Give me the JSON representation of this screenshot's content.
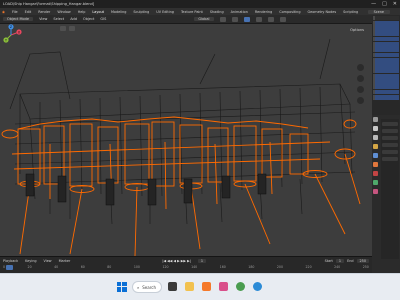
{
  "window": {
    "path": "LOAD\\Ship Hangar\\Format\\Shipping_Hangar.blend]",
    "buttons": [
      "—",
      "□",
      "✕"
    ]
  },
  "menus": [
    "File",
    "Edit",
    "Render",
    "Window",
    "Help"
  ],
  "workspaces": [
    "Layout",
    "Modeling",
    "Sculpting",
    "UV Editing",
    "Texture Paint",
    "Shading",
    "Animation",
    "Rendering",
    "Compositing",
    "Geometry Nodes",
    "Scripting"
  ],
  "active_workspace": "Layout",
  "scene_name": "Scene",
  "header": {
    "mode": "Object Mode",
    "menus": [
      "View",
      "Select",
      "Add",
      "Object",
      "GIS"
    ],
    "transform": "Global"
  },
  "viewport": {
    "options_label": "Options",
    "selection_color": "#ff6a00",
    "wire_color": "#111111",
    "gizmo": {
      "x": "X",
      "y": "Y",
      "z": "Z"
    }
  },
  "timeline": {
    "menus": [
      "Playback",
      "Keying",
      "View",
      "Marker"
    ],
    "current_frame": "1",
    "start_label": "Start",
    "start": "1",
    "end_label": "End",
    "end": "250",
    "ruler": [
      "0",
      "20",
      "40",
      "60",
      "80",
      "100",
      "120",
      "140",
      "160",
      "180",
      "200",
      "220",
      "240",
      "250"
    ]
  },
  "taskbar": {
    "search_label": "Search",
    "icon_names": [
      "files-icon",
      "explorer-icon",
      "blender-icon",
      "app-icon",
      "chrome-icon",
      "edge-icon"
    ]
  }
}
